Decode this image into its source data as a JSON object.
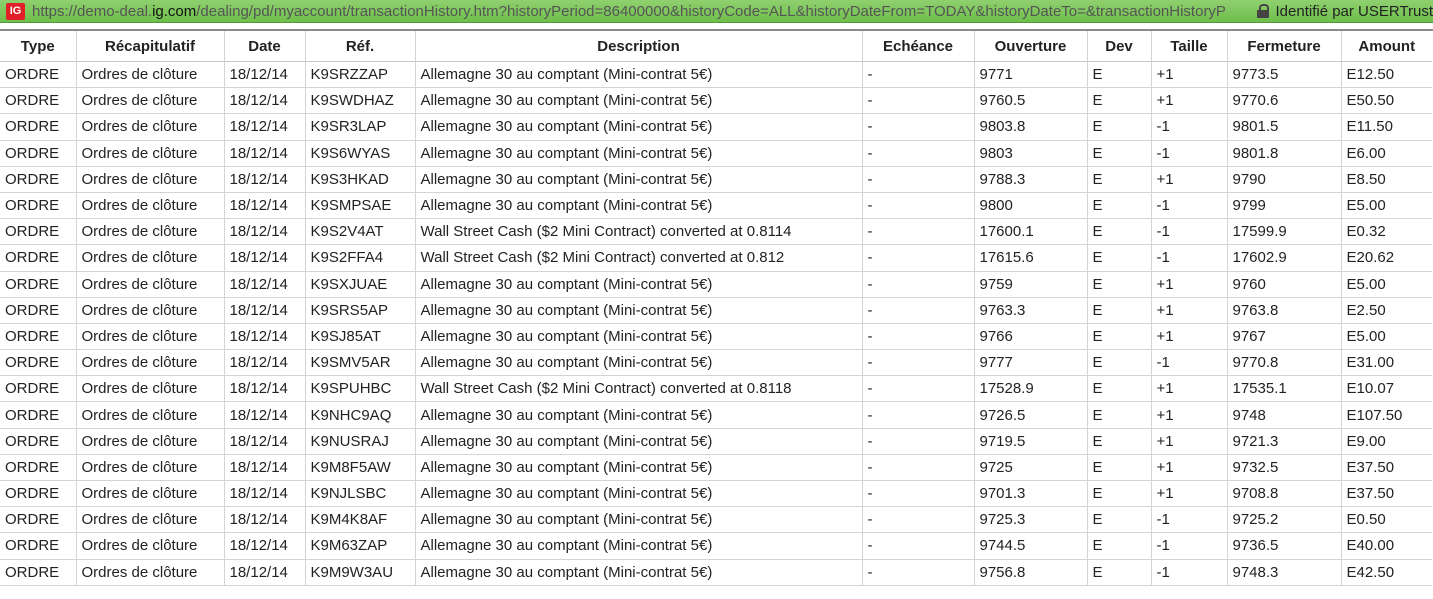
{
  "browser": {
    "url_scheme": "https://demo-deal.",
    "url_host": "ig.com",
    "url_path": "/dealing/pd/myaccount/transactionHistory.htm?historyPeriod=86400000&historyCode=ALL&historyDateFrom=TODAY&historyDateTo=&transactionHistoryP",
    "identity": "Identifié par USERTrust",
    "logo_text": "IG"
  },
  "table": {
    "headers": [
      "Type",
      "Récapitulatif",
      "Date",
      "Réf.",
      "Description",
      "Echéance",
      "Ouverture",
      "Dev",
      "Taille",
      "Fermeture",
      "Amount"
    ],
    "rows": [
      [
        "ORDRE",
        "Ordres de clôture",
        "18/12/14",
        "K9SRZZAP",
        "Allemagne 30 au comptant (Mini-contrat 5€)",
        "-",
        "9771",
        "E",
        "+1",
        "9773.5",
        "E12.50"
      ],
      [
        "ORDRE",
        "Ordres de clôture",
        "18/12/14",
        "K9SWDHAZ",
        "Allemagne 30 au comptant (Mini-contrat 5€)",
        "-",
        "9760.5",
        "E",
        "+1",
        "9770.6",
        "E50.50"
      ],
      [
        "ORDRE",
        "Ordres de clôture",
        "18/12/14",
        "K9SR3LAP",
        "Allemagne 30 au comptant (Mini-contrat 5€)",
        "-",
        "9803.8",
        "E",
        "-1",
        "9801.5",
        "E11.50"
      ],
      [
        "ORDRE",
        "Ordres de clôture",
        "18/12/14",
        "K9S6WYAS",
        "Allemagne 30 au comptant (Mini-contrat 5€)",
        "-",
        "9803",
        "E",
        "-1",
        "9801.8",
        "E6.00"
      ],
      [
        "ORDRE",
        "Ordres de clôture",
        "18/12/14",
        "K9S3HKAD",
        "Allemagne 30 au comptant (Mini-contrat 5€)",
        "-",
        "9788.3",
        "E",
        "+1",
        "9790",
        "E8.50"
      ],
      [
        "ORDRE",
        "Ordres de clôture",
        "18/12/14",
        "K9SMPSAE",
        "Allemagne 30 au comptant (Mini-contrat 5€)",
        "-",
        "9800",
        "E",
        "-1",
        "9799",
        "E5.00"
      ],
      [
        "ORDRE",
        "Ordres de clôture",
        "18/12/14",
        "K9S2V4AT",
        "Wall Street Cash ($2 Mini Contract) converted at 0.8114",
        "-",
        "17600.1",
        "E",
        "-1",
        "17599.9",
        "E0.32"
      ],
      [
        "ORDRE",
        "Ordres de clôture",
        "18/12/14",
        "K9S2FFA4",
        "Wall Street Cash ($2 Mini Contract) converted at 0.812",
        "-",
        "17615.6",
        "E",
        "-1",
        "17602.9",
        "E20.62"
      ],
      [
        "ORDRE",
        "Ordres de clôture",
        "18/12/14",
        "K9SXJUAE",
        "Allemagne 30 au comptant (Mini-contrat 5€)",
        "-",
        "9759",
        "E",
        "+1",
        "9760",
        "E5.00"
      ],
      [
        "ORDRE",
        "Ordres de clôture",
        "18/12/14",
        "K9SRS5AP",
        "Allemagne 30 au comptant (Mini-contrat 5€)",
        "-",
        "9763.3",
        "E",
        "+1",
        "9763.8",
        "E2.50"
      ],
      [
        "ORDRE",
        "Ordres de clôture",
        "18/12/14",
        "K9SJ85AT",
        "Allemagne 30 au comptant (Mini-contrat 5€)",
        "-",
        "9766",
        "E",
        "+1",
        "9767",
        "E5.00"
      ],
      [
        "ORDRE",
        "Ordres de clôture",
        "18/12/14",
        "K9SMV5AR",
        "Allemagne 30 au comptant (Mini-contrat 5€)",
        "-",
        "9777",
        "E",
        "-1",
        "9770.8",
        "E31.00"
      ],
      [
        "ORDRE",
        "Ordres de clôture",
        "18/12/14",
        "K9SPUHBC",
        "Wall Street Cash ($2 Mini Contract) converted at 0.8118",
        "-",
        "17528.9",
        "E",
        "+1",
        "17535.1",
        "E10.07"
      ],
      [
        "ORDRE",
        "Ordres de clôture",
        "18/12/14",
        "K9NHC9AQ",
        "Allemagne 30 au comptant (Mini-contrat 5€)",
        "-",
        "9726.5",
        "E",
        "+1",
        "9748",
        "E107.50"
      ],
      [
        "ORDRE",
        "Ordres de clôture",
        "18/12/14",
        "K9NUSRAJ",
        "Allemagne 30 au comptant (Mini-contrat 5€)",
        "-",
        "9719.5",
        "E",
        "+1",
        "9721.3",
        "E9.00"
      ],
      [
        "ORDRE",
        "Ordres de clôture",
        "18/12/14",
        "K9M8F5AW",
        "Allemagne 30 au comptant (Mini-contrat 5€)",
        "-",
        "9725",
        "E",
        "+1",
        "9732.5",
        "E37.50"
      ],
      [
        "ORDRE",
        "Ordres de clôture",
        "18/12/14",
        "K9NJLSBC",
        "Allemagne 30 au comptant (Mini-contrat 5€)",
        "-",
        "9701.3",
        "E",
        "+1",
        "9708.8",
        "E37.50"
      ],
      [
        "ORDRE",
        "Ordres de clôture",
        "18/12/14",
        "K9M4K8AF",
        "Allemagne 30 au comptant (Mini-contrat 5€)",
        "-",
        "9725.3",
        "E",
        "-1",
        "9725.2",
        "E0.50"
      ],
      [
        "ORDRE",
        "Ordres de clôture",
        "18/12/14",
        "K9M63ZAP",
        "Allemagne 30 au comptant (Mini-contrat 5€)",
        "-",
        "9744.5",
        "E",
        "-1",
        "9736.5",
        "E40.00"
      ],
      [
        "ORDRE",
        "Ordres de clôture",
        "18/12/14",
        "K9M9W3AU",
        "Allemagne 30 au comptant (Mini-contrat 5€)",
        "-",
        "9756.8",
        "E",
        "-1",
        "9748.3",
        "E42.50"
      ]
    ]
  }
}
